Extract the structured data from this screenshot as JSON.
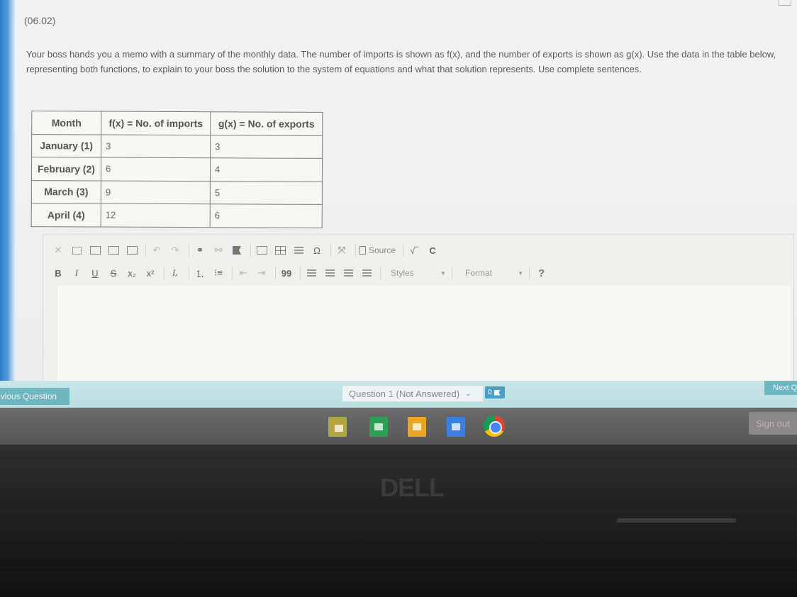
{
  "header": {
    "question_code": "(06.02)"
  },
  "prompt": "Your boss hands you a memo with a summary of the monthly data. The number of imports is shown as f(x), and the number of exports is shown as g(x). Use the data in the table below, representing both functions, to explain to your boss the solution to the system of equations and what that solution represents. Use complete sentences.",
  "table": {
    "headers": [
      "Month",
      "f(x) = No. of imports",
      "g(x) = No. of exports"
    ],
    "rows": [
      [
        "January (1)",
        "3",
        "3"
      ],
      [
        "February (2)",
        "6",
        "4"
      ],
      [
        "March (3)",
        "9",
        "5"
      ],
      [
        "April (4)",
        "12",
        "6"
      ]
    ]
  },
  "editor": {
    "source_label": "Source",
    "styles_label": "Styles",
    "format_label": "Format",
    "help_label": "?",
    "bold": "B",
    "italic": "I",
    "underline": "U",
    "strike": "S",
    "omega": "Ω",
    "quote": "99"
  },
  "nav": {
    "prev_label": "evious Question",
    "question_select": "Question 1 (Not Answered)",
    "flag_count": "0",
    "next_label": "Next Q"
  },
  "shelf": {
    "sign_out": "Sign out"
  },
  "brand": "DELL"
}
